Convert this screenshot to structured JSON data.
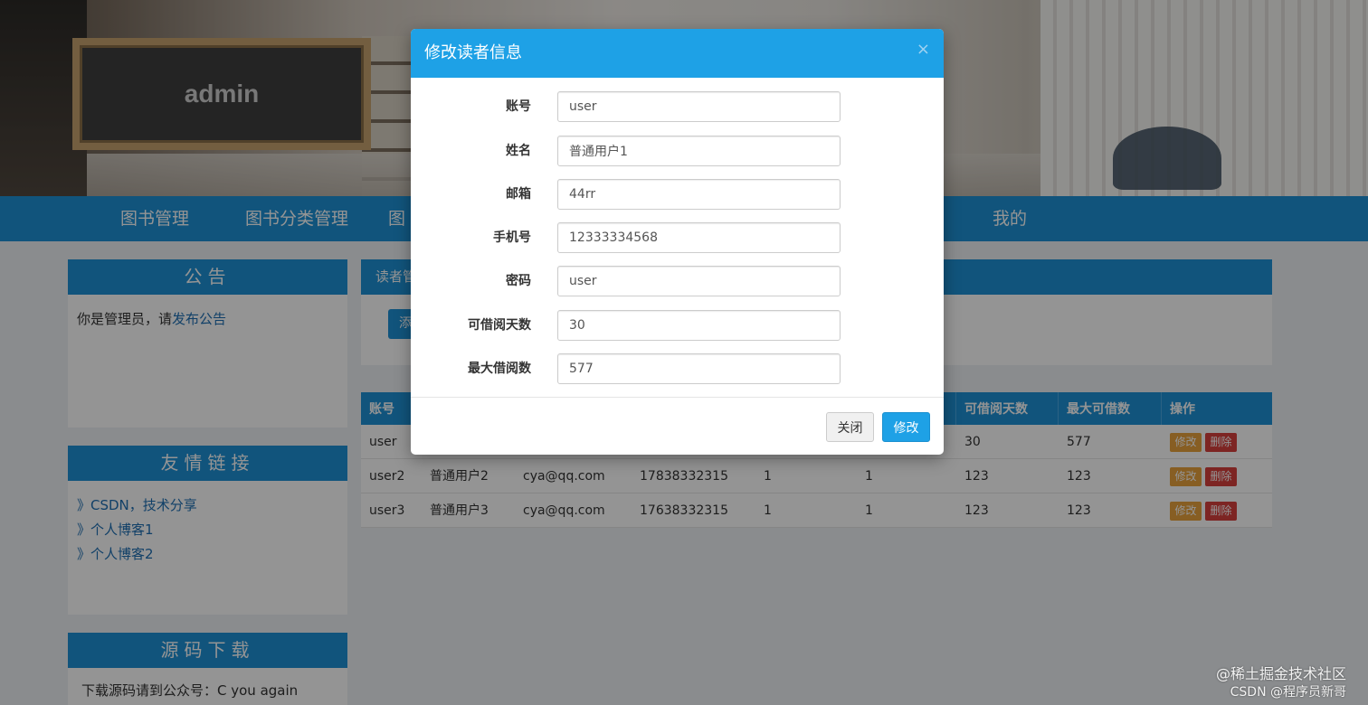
{
  "header": {
    "title": "admin"
  },
  "nav": {
    "items": [
      "图书管理",
      "图书分类管理",
      "图",
      "我的"
    ]
  },
  "sidebar": {
    "notice": {
      "title": "公告",
      "text": "你是管理员，请",
      "link": "发布公告"
    },
    "links": {
      "title": "友情链接",
      "items": [
        "》CSDN，技术分享",
        "》个人博客1",
        "》个人博客2"
      ]
    },
    "download": {
      "title": "源码下载",
      "text": "下载源码请到公众号：C you again"
    }
  },
  "main": {
    "title": "读者管",
    "add_button": "添",
    "table": {
      "headers": [
        "账号",
        "",
        "",
        "",
        "",
        "",
        "可借阅天数",
        "最大可借数",
        "操作"
      ],
      "rows": [
        [
          "user",
          "",
          "",
          "",
          "",
          "",
          "30",
          "577"
        ],
        [
          "user2",
          "普通用户2",
          "cya@qq.com",
          "17838332315",
          "1",
          "1",
          "123",
          "123"
        ],
        [
          "user3",
          "普通用户3",
          "cya@qq.com",
          "17638332315",
          "1",
          "1",
          "123",
          "123"
        ]
      ],
      "edit_label": "修改",
      "delete_label": "删除"
    }
  },
  "modal": {
    "title": "修改读者信息",
    "close_icon": "×",
    "fields": [
      {
        "label": "账号",
        "value": "user"
      },
      {
        "label": "姓名",
        "value": "普通用户1"
      },
      {
        "label": "邮箱",
        "value": "44rr"
      },
      {
        "label": "手机号",
        "value": "12333334568"
      },
      {
        "label": "密码",
        "value": "user"
      },
      {
        "label": "可借阅天数",
        "value": "30"
      },
      {
        "label": "最大借阅数",
        "value": "577"
      }
    ],
    "close_button": "关闭",
    "submit_button": "修改"
  },
  "watermark": {
    "line1": "@稀土掘金技术社区",
    "line2": "CSDN @程序员新哥"
  },
  "colors": {
    "primary": "#1e91d6",
    "modal_header": "#1ea1e6",
    "edit": "#e8a33d",
    "delete": "#d8413d"
  }
}
